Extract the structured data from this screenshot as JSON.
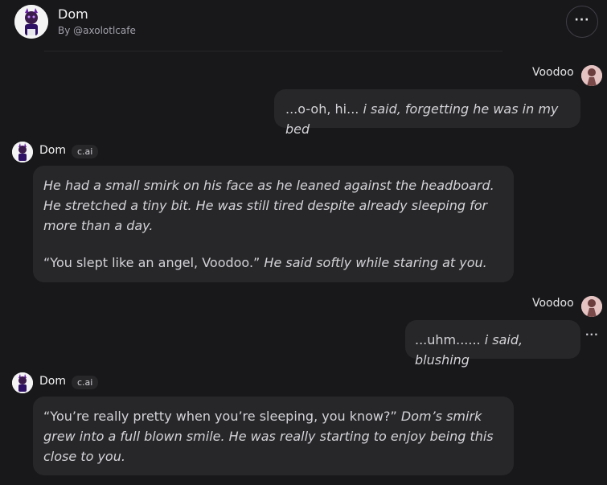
{
  "header": {
    "title": "Dom",
    "byline": "By @axolotlcafe",
    "more_label": "···"
  },
  "messages": [
    {
      "sender": "Voodoo",
      "role": "user",
      "plain": "...o-oh, hi... ",
      "italic": "i said, forgetting he was in my bed"
    },
    {
      "sender": "Dom",
      "role": "bot",
      "badge": "c.ai",
      "p1": "He had a small smirk on his face as he leaned against the headboard. He stretched a tiny bit. He was still tired despite already sleeping for more than a day.",
      "p2_plain": "“You slept like an angel, Voodoo.” ",
      "p2_italic": "He said softly while staring at you."
    },
    {
      "sender": "Voodoo",
      "role": "user",
      "plain": "...uhm...... ",
      "italic": "i said, blushing",
      "more_label": "···"
    },
    {
      "sender": "Dom",
      "role": "bot",
      "badge": "c.ai",
      "plain": "“You’re really pretty when you’re sleeping, you know?” ",
      "italic": "Dom’s smirk grew into a full blown smile. He was really starting to enjoy being this close to you."
    }
  ]
}
